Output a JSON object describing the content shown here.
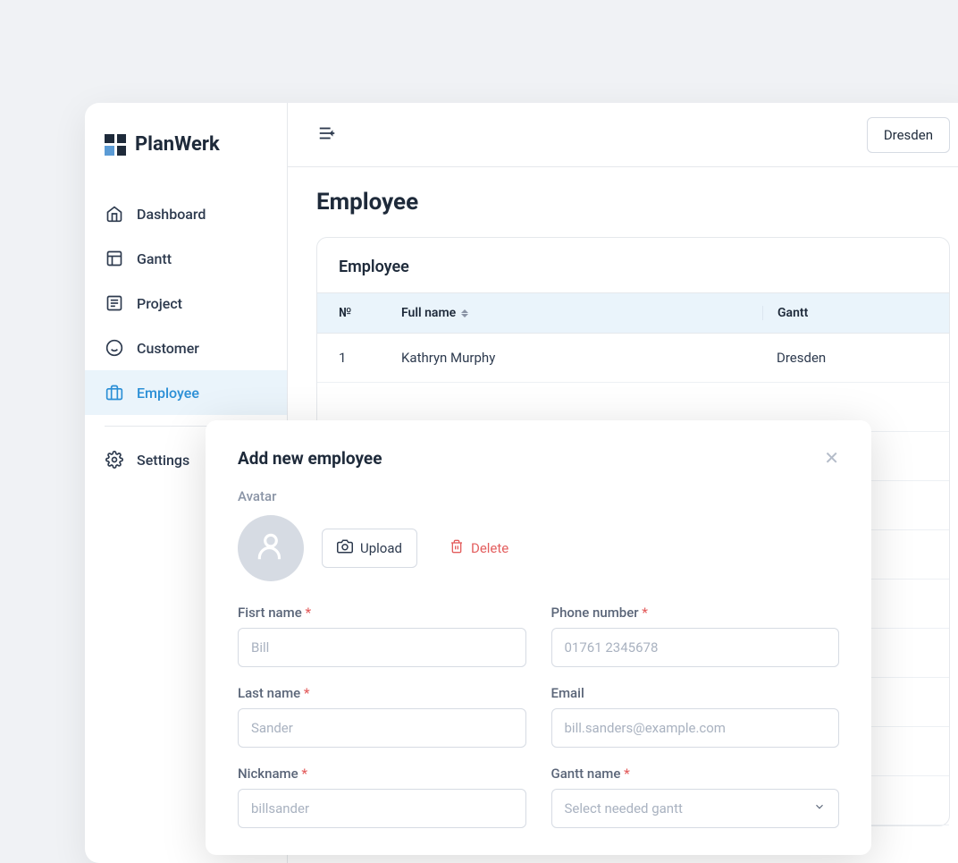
{
  "app": {
    "name": "PlanWerk"
  },
  "sidebar": {
    "items": [
      {
        "id": "dashboard",
        "label": "Dashboard"
      },
      {
        "id": "gantt",
        "label": "Gantt"
      },
      {
        "id": "project",
        "label": "Project"
      },
      {
        "id": "customer",
        "label": "Customer"
      },
      {
        "id": "employee",
        "label": "Employee"
      },
      {
        "id": "settings",
        "label": "Settings"
      }
    ]
  },
  "topbar": {
    "location": "Dresden"
  },
  "page": {
    "title": "Employee"
  },
  "employee_card": {
    "title": "Employee",
    "columns": {
      "num": "№",
      "fullname": "Full name",
      "gantt": "Gantt"
    },
    "rows": [
      {
        "num": "1",
        "fullname": "Kathryn Murphy",
        "gantt": "Dresden"
      }
    ]
  },
  "modal": {
    "title": "Add new employee",
    "avatar_label": "Avatar",
    "upload_label": "Upload",
    "delete_label": "Delete",
    "fields": {
      "first_name": {
        "label": "Fisrt name",
        "required": true,
        "placeholder": "Bill"
      },
      "phone": {
        "label": "Phone number",
        "required": true,
        "placeholder": "01761 2345678"
      },
      "last_name": {
        "label": "Last name",
        "required": true,
        "placeholder": "Sander"
      },
      "email": {
        "label": "Email",
        "required": false,
        "placeholder": "bill.sanders@example.com"
      },
      "nickname": {
        "label": "Nickname",
        "required": true,
        "placeholder": "billsander"
      },
      "gantt_name": {
        "label": "Gantt name",
        "required": true,
        "placeholder": "Select needed gantt"
      }
    }
  }
}
